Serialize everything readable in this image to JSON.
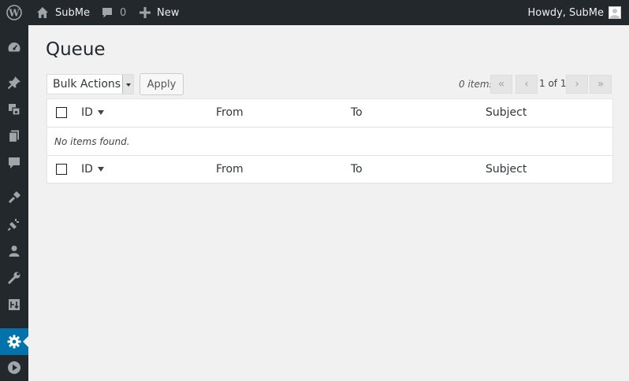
{
  "adminbar": {
    "site_name": "SubMe",
    "comments_count": "0",
    "new_label": "New",
    "howdy": "Howdy, SubMe"
  },
  "sidebar": {
    "items": [
      {
        "icon": "dashboard-icon"
      },
      {
        "icon": "pin-icon"
      },
      {
        "icon": "media-icon"
      },
      {
        "icon": "pages-icon"
      },
      {
        "icon": "comments-icon"
      },
      {
        "icon": "appearance-icon"
      },
      {
        "icon": "plugins-icon"
      },
      {
        "icon": "users-icon"
      },
      {
        "icon": "tools-icon"
      },
      {
        "icon": "import-icon"
      },
      {
        "icon": "settings-icon",
        "current": true
      },
      {
        "icon": "play-icon"
      }
    ]
  },
  "page": {
    "title": "Queue"
  },
  "toolbar": {
    "bulk_actions": "Bulk Actions",
    "apply": "Apply",
    "items_count": "0 items",
    "first": "«",
    "prev": "‹",
    "current_page": "1 of 1",
    "next": "›",
    "last": "»"
  },
  "table": {
    "columns": [
      "ID",
      "From",
      "To",
      "Subject"
    ],
    "empty_message": "No items found."
  },
  "colors": {
    "adminbar_bg": "#23282d",
    "accent": "#0073aa",
    "page_bg": "#f1f1f1"
  }
}
